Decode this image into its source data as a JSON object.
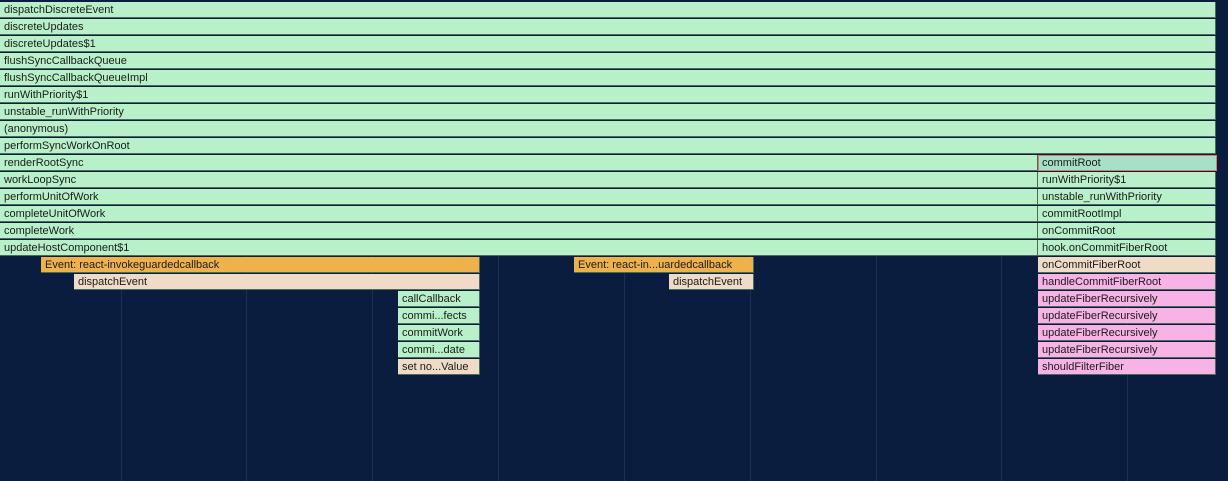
{
  "flame": {
    "left_stack": [
      "dispatchDiscreteEvent",
      "discreteUpdates",
      "discreteUpdates$1",
      "flushSyncCallbackQueue",
      "flushSyncCallbackQueueImpl",
      "runWithPriority$1",
      "unstable_runWithPriority",
      "(anonymous)",
      "performSyncWorkOnRoot",
      "renderRootSync",
      "workLoopSync",
      "performUnitOfWork",
      "completeUnitOfWork",
      "completeWork",
      "updateHostComponent$1"
    ],
    "event_a": "Event: react-invokeguardedcallback",
    "event_a_dispatch": "dispatchEvent",
    "event_a_children": [
      "callCallback",
      "commi...fects",
      "commitWork",
      "commi...date",
      "set no...Value"
    ],
    "event_b": "Event: react-in...uardedcallback",
    "event_b_dispatch": "dispatchEvent",
    "right_stack": [
      "commitRoot",
      "runWithPriority$1",
      "unstable_runWithPriority",
      "commitRootImpl",
      "onCommitRoot",
      "hook.onCommitFiberRoot",
      "onCommitFiberRoot",
      "handleCommitFiberRoot",
      "updateFiberRecursively",
      "updateFiberRecursively",
      "updateFiberRecursively",
      "updateFiberRecursively",
      "shouldFilterFiber"
    ],
    "colors": {
      "background": "#0a1d3e",
      "green": "#b7f0c9",
      "orange": "#efb24a",
      "beige": "#f0dbc6",
      "pink": "#f7b3e6",
      "selected_outline": "#e2766f"
    }
  }
}
